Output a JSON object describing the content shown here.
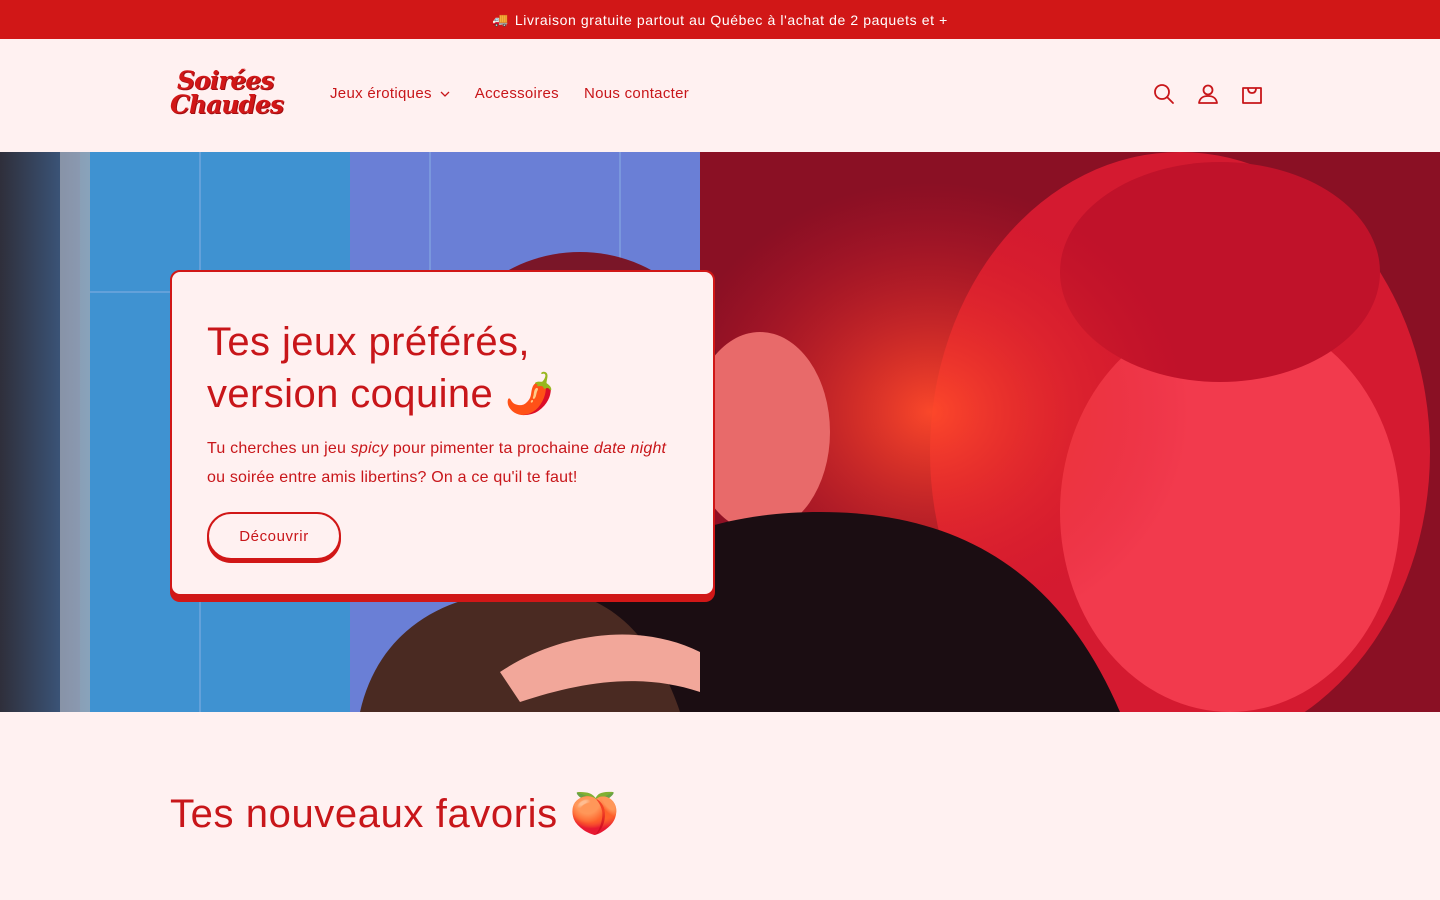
{
  "announcement": {
    "icon": "truck-icon",
    "emoji": "🚚",
    "text": "Livraison gratuite partout au Québec à l'achat de 2 paquets et +"
  },
  "header": {
    "logo_line1": "Soirées",
    "logo_line2": "Chaudes",
    "nav": [
      {
        "label": "Jeux érotiques",
        "has_dropdown": true
      },
      {
        "label": "Accessoires"
      },
      {
        "label": "Nous contacter"
      }
    ],
    "icons": [
      "search-icon",
      "account-icon",
      "cart-icon"
    ]
  },
  "hero": {
    "title_line1": "Tes jeux préférés,",
    "title_line2": "version coquine 🌶️",
    "text_part1": "Tu cherches un jeu ",
    "text_em1": "spicy",
    "text_part2": " pour pimenter ta prochaine ",
    "text_em2": "date night",
    "text_part3": " ou soirée entre amis libertins? On a ce qu'il te faut!",
    "button_label": "Découvrir"
  },
  "section": {
    "title": "Tes nouveaux favoris 🍑"
  },
  "colors": {
    "brand_red": "#d11717",
    "background": "#fff1f1"
  }
}
